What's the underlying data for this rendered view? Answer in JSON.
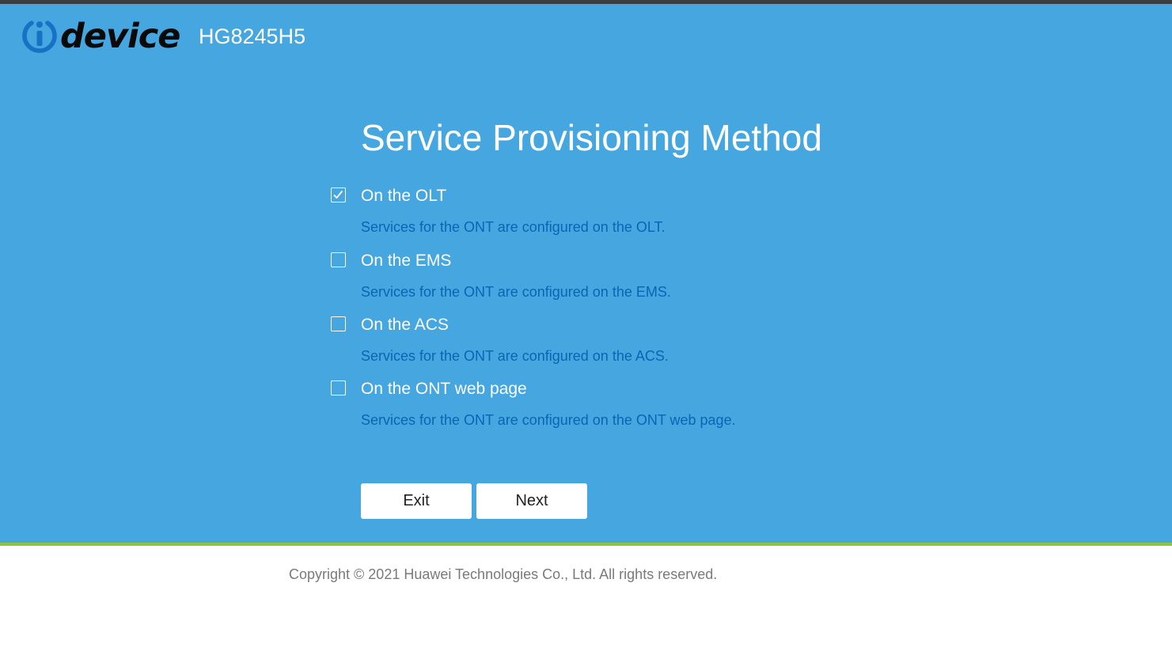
{
  "header": {
    "brand": "device",
    "model": "HG8245H5"
  },
  "page": {
    "title": "Service Provisioning Method"
  },
  "options": [
    {
      "label": "On the OLT",
      "description": "Services for the ONT are configured on the OLT.",
      "checked": true
    },
    {
      "label": "On the EMS",
      "description": "Services for the ONT are configured on the EMS.",
      "checked": false
    },
    {
      "label": "On the ACS",
      "description": "Services for the ONT are configured on the ACS.",
      "checked": false
    },
    {
      "label": "On the ONT web page",
      "description": "Services for the ONT are configured on the ONT web page.",
      "checked": false
    }
  ],
  "buttons": {
    "exit": "Exit",
    "next": "Next"
  },
  "footer": {
    "copyright": "Copyright © 2021 Huawei Technologies Co., Ltd. All rights reserved."
  },
  "colors": {
    "background": "#45a6e0",
    "accent_line": "#8cc63e",
    "description_text": "#0a65b4",
    "logo_blue": "#1572c4"
  }
}
